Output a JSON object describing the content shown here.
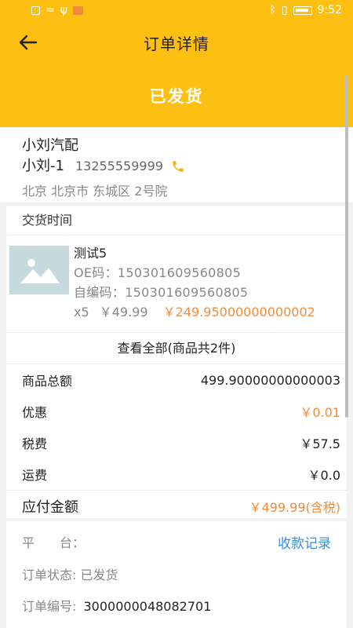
{
  "status_bar": {
    "time": "9:52"
  },
  "nav": {
    "title": "订单详情"
  },
  "order_status": "已发货",
  "address": {
    "shop": "小刘汽配",
    "contact_name": "小刘-1",
    "phone": "13255559999",
    "full_address": "北京 北京市 东城区 2号院"
  },
  "goods": {
    "delivery_label": "交货时间",
    "item": {
      "name": "测试5",
      "oe_label": "OE码：",
      "oe_code": "150301609560805",
      "self_code_label": "自编码：",
      "self_code": "150301609560805",
      "qty": "x5",
      "unit_price": "￥49.99",
      "total": "￥249.95000000000002"
    },
    "view_all": "查看全部(商品共2件)"
  },
  "summary": {
    "goods_total_label": "商品总额",
    "goods_total_value": "499.90000000000003",
    "discount_label": "优惠",
    "discount_value": "￥0.01",
    "tax_label": "税费",
    "tax_value": "￥57.5",
    "shipping_label": "运费",
    "shipping_value": "￥0.0",
    "payable_label": "应付金额",
    "payable_value": "￥499.99(含税)"
  },
  "platform": {
    "label": "平　　台：",
    "link": "收款记录",
    "order_status_text": "订单状态: 已发货",
    "order_no_label": "订单编号:",
    "order_no": "3000000048082701"
  },
  "colors": {
    "brand": "#fdbf12",
    "accent": "#f28c3a",
    "link": "#3a8ee6"
  },
  "icons": [
    "back-arrow-icon",
    "phone-icon",
    "image-placeholder-icon"
  ]
}
